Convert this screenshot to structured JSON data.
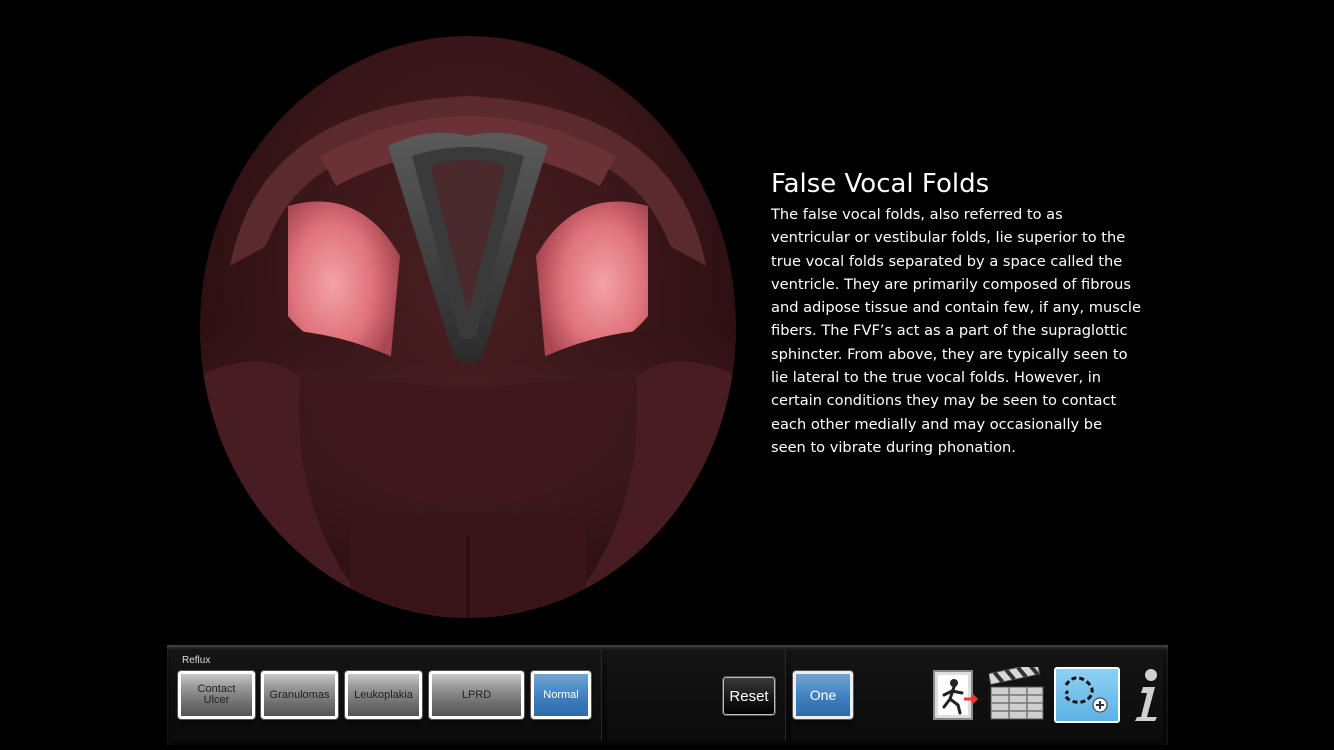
{
  "panel": {
    "title": "False Vocal Folds",
    "body": "The false vocal folds, also referred to as ventricular or vestibular folds, lie superior to the true vocal folds separated by a space called the ventricle. They are primarily composed of fibrous and adipose tissue and contain  few, if any, muscle fibers.  The FVF’s act as a part of the supraglottic sphincter.  From above, they are typically seen to lie lateral to the true vocal folds.  However, in certain  conditions they may be seen to contact each other medially and may occasionally be seen to vibrate during phonation."
  },
  "toolbar": {
    "group_label": "Reflux",
    "buttons": [
      {
        "line1": "Contact",
        "line2": "Ulcer"
      },
      {
        "line1": "Granulomas",
        "line2": ""
      },
      {
        "line1": "Leukoplakia",
        "line2": ""
      },
      {
        "line1": "LPRD",
        "line2": ""
      }
    ],
    "normal_label": "Normal",
    "normal_selected": true,
    "reset_label": "Reset",
    "one_label": "One",
    "icons": [
      "exit-icon",
      "video-clapper-icon",
      "path-draw-icon",
      "info-icon"
    ]
  },
  "colors": {
    "selected_blue": "#3e7fbd",
    "fold_pink": "#e57a82"
  }
}
